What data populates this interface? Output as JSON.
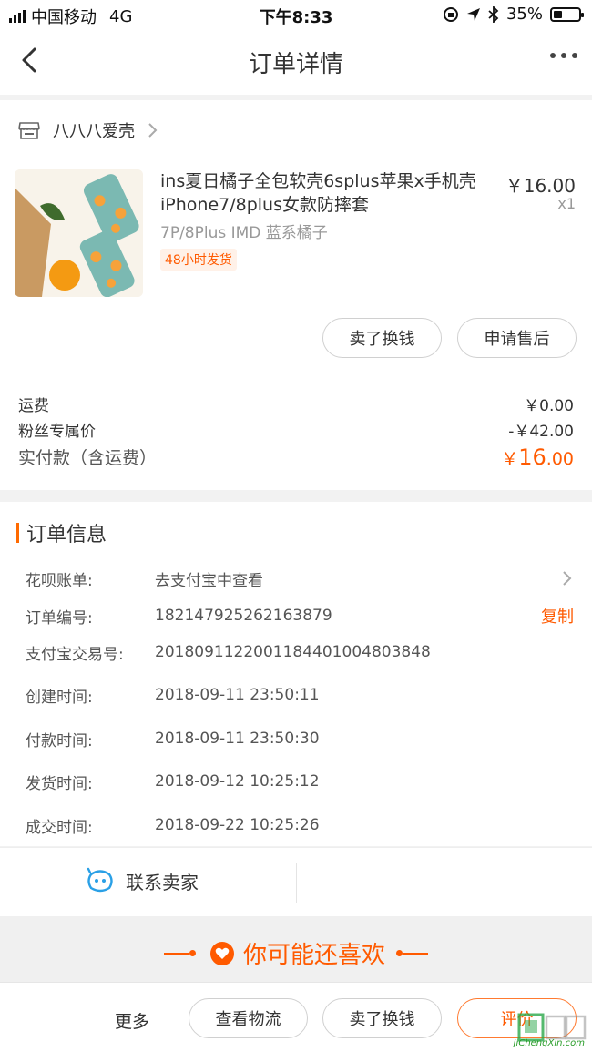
{
  "status_bar": {
    "carrier": "中国移动",
    "network": "4G",
    "time": "下午8:33",
    "battery_percent": "35%",
    "battery_level": 0.35
  },
  "nav": {
    "title": "订单详情"
  },
  "shop": {
    "name": "八八八爱壳"
  },
  "product": {
    "title": "ins夏日橘子全包软壳6splus苹果x手机壳iPhone7/8plus女款防摔套",
    "price": "￥16.00",
    "quantity": "x1",
    "sku": "7P/8Plus IMD 蓝系橘子",
    "ship_tag": "48小时发货"
  },
  "actions": {
    "sell_label": "卖了换钱",
    "after_sale_label": "申请售后"
  },
  "fees": {
    "shipping_label": "运费",
    "shipping_value": "￥0.00",
    "fan_price_label": "粉丝专属价",
    "fan_price_value": "-￥42.00",
    "total_label": "实付款（含运费）",
    "total_currency": "￥",
    "total_int": "16",
    "total_dec": ".00"
  },
  "order_info": {
    "title": "订单信息",
    "rows": [
      {
        "label": "花呗账单:",
        "value": "去支付宝中查看"
      },
      {
        "label": "订单编号:",
        "value": "182147925262163879",
        "action": "复制"
      },
      {
        "label": "支付宝交易号:",
        "value": "2018091122001184401004803848"
      },
      {
        "label": "创建时间:",
        "value": "2018-09-11 23:50:11"
      },
      {
        "label": "付款时间:",
        "value": "2018-09-11 23:50:30"
      },
      {
        "label": "发货时间:",
        "value": "2018-09-12 10:25:12"
      },
      {
        "label": "成交时间:",
        "value": "2018-09-22 10:25:26"
      }
    ]
  },
  "contact": {
    "label": "联系卖家"
  },
  "recommend": {
    "title": "你可能还喜欢"
  },
  "bottom_bar": {
    "more_label": "更多",
    "logistics_label": "查看物流",
    "sell_label": "卖了换钱",
    "rate_label": "评价"
  },
  "watermark": {
    "text": "JiChengXin.com"
  },
  "colors": {
    "accent": "#ff5a00",
    "background": "#f2f2f2"
  }
}
